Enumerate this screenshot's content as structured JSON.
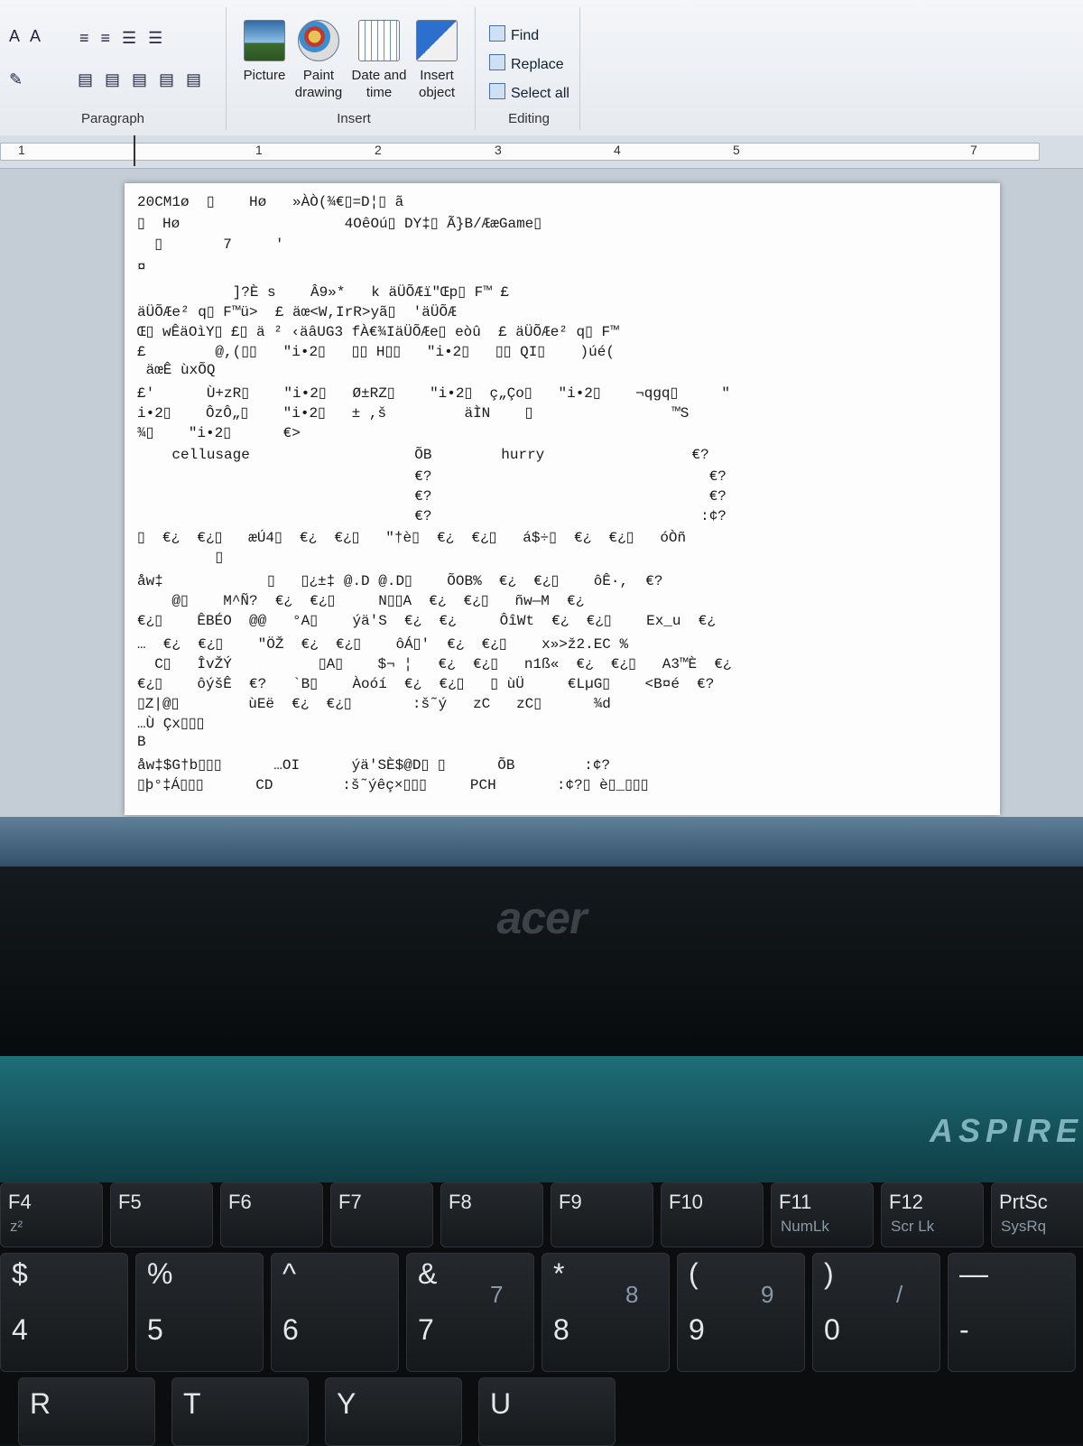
{
  "ribbon": {
    "font_controls": "A A",
    "paragraph_label": "Paragraph",
    "insert_label": "Insert",
    "editing_label": "Editing",
    "buttons": {
      "picture": "Picture",
      "paint": "Paint drawing",
      "datetime": "Date and time",
      "object": "Insert object"
    },
    "editing": {
      "find": "Find",
      "replace": "Replace",
      "select_all": "Select all"
    }
  },
  "ruler": {
    "ticks": [
      "1",
      "1",
      "2",
      "3",
      "4",
      "5",
      "7"
    ]
  },
  "document": {
    "lines": [
      "20CM1ø  ▯    Hø   »ÀÒ(¾€▯=D¦▯ ã",
      "▯  Hø                   4OêOú▯ DY‡▯ Ã}B/ÆæGame▯",
      "  ▯       7     '",
      "¤",
      "           ]?È s    Â9»*   k äÜÕÆï\"Œp▯ F™ £",
      "äÜÕÆe² q▯ F™ü>  £ äœ<W,IrR>yã▯  'äÜÕÆ",
      "Œ▯ wÊäOìY▯ £▯ ä ² ‹äâUG3 fÀ€¾IäÜÕÆe▯ eòû  £ äÜÕÆe² q▯ F™",
      "£        @,(▯▯   \"i•2▯   ▯▯ H▯▯   \"i•2▯   ▯▯ QI▯    )úé(",
      " äœÊ ùxÕQ",
      "£'      Ù+zR▯    \"i•2▯   Ø±RZ▯    \"i•2▯  ç„Çо▯   \"i•2▯    ¬qgq▯     \"",
      "i•2▯    ÔzÔ„▯    \"i•2▯   ± ,š         äÌN    ▯                ™S",
      "¾▯    \"i•2▯      €>",
      "    cellusage                   ÕB        hurry                 €?",
      "                                €?                                €?",
      "                                €?                                €?",
      "                                €?                               :¢?",
      "▯  €¿  €¿▯   æÚ4▯  €¿  €¿▯   \"†è▯  €¿  €¿▯   á$÷▯  €¿  €¿▯   óÒñ",
      "         ▯",
      "åw‡            ▯   ▯¿±‡ @.D @.D▯    ÕOB%  €¿  €¿▯    ôÊ·,  €?",
      "    @▯    M^Ñ?  €¿  €¿▯     N▯▯A  €¿  €¿▯   ñw—M  €¿",
      "€¿▯    ÊBÉO  @@   °A▯    ýä'S  €¿  €¿     ÔîWt  €¿  €¿▯    Ex_u  €¿",
      "…  €¿  €¿▯    \"ÖŽ  €¿  €¿▯    ôÁ▯'  €¿  €¿▯    x»>ž2.EC %",
      "  C▯   ÎvŽÝ          ▯A▯    $¬ ¦   €¿  €¿▯   n1ß«  €¿  €¿▯   A3™È  €¿",
      "€¿▯    ôýšÊ  €?   `B▯    Àoóí  €¿  €¿▯   ▯ ùÜ     €LµG▯    <B¤é  €?",
      "▯Z|@▯        ùEë  €¿  €¿▯       :š˜ý   zC   zC▯      ¾d",
      "…Ù Çx▯▯▯",
      "B",
      "åw‡$G†b▯▯▯      …OI      ýä'SÈ$@D▯ ▯      ÕB        :¢?",
      "▯þ°‡Á▯▯▯      CD        :š˜ýêç×▯▯▯     PCH       :¢?▯ è▯_▯▯▯"
    ]
  },
  "laptop": {
    "brand": "acer",
    "model": "ASPIRE",
    "keys_fn": [
      {
        "label": "F4",
        "sub": "z²"
      },
      {
        "label": "F5",
        "sub": ""
      },
      {
        "label": "F6",
        "sub": ""
      },
      {
        "label": "F7",
        "sub": ""
      },
      {
        "label": "F8",
        "sub": ""
      },
      {
        "label": "F9",
        "sub": ""
      },
      {
        "label": "F10",
        "sub": ""
      },
      {
        "label": "F11",
        "sub": "NumLk"
      },
      {
        "label": "F12",
        "sub": "Scr Lk"
      },
      {
        "label": "PrtSc",
        "sub": "SysRq"
      }
    ],
    "keys_num": [
      {
        "top": "$",
        "bottom": "4",
        "side": ""
      },
      {
        "top": "%",
        "bottom": "5",
        "side": ""
      },
      {
        "top": "^",
        "bottom": "6",
        "side": ""
      },
      {
        "top": "&",
        "bottom": "7",
        "side": "7"
      },
      {
        "top": "*",
        "bottom": "8",
        "side": "8"
      },
      {
        "top": "(",
        "bottom": "9",
        "side": "9"
      },
      {
        "top": ")",
        "bottom": "0",
        "side": "/"
      },
      {
        "top": "—",
        "bottom": "-",
        "side": ""
      }
    ],
    "keys_alpha": [
      "R",
      "T",
      "Y",
      "U"
    ]
  }
}
